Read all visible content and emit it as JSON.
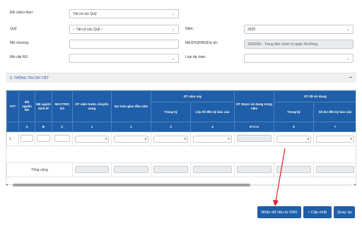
{
  "form": {
    "doi_chieu_label": "Đối chiếu theo:",
    "doi_chieu_value": "Tất cả các Quỹ",
    "quy_label": "Quỹ:",
    "quy_value": "-- Tất cả các Quỹ --",
    "nam_label": "Năm:",
    "nam_value": "2025",
    "ma_chuong_label": "Mã chương:",
    "ma_chuong_value": "",
    "ma_dvqhns_label": "Mã ĐVQHNS/Dự án:",
    "ma_dvqhns_value": "1025060 - Trung tâm chính trị quận Hà Đông",
    "ma_cap_ns_label": "Mã cấp NS:",
    "ma_cap_ns_value": "",
    "loai_du_toan_label": "Loại dự toán:",
    "loai_du_toan_value": ""
  },
  "section": {
    "title": "II. THÔNG TIN CHI TIẾT",
    "collapse_icon": "minus-icon"
  },
  "table": {
    "headers": {
      "stt": "STT",
      "ma_nguon": "Mã nguồn NS",
      "ma_nganh": "Mã ngành kinh tế",
      "ma_ctmt": "Mã CTMT, DA",
      "dt_nam_truoc": "DT năm trước chuyển sang",
      "du_toan_giao": "Dự toán giao đầu năm",
      "dt_nam_nay": "DT năm nay",
      "trong_ky": "Trong kỳ",
      "luy_ke": "Lũy kế đến kỳ báo cáo",
      "dt_duoc_su_dung": "DT được sử dụng trong năm",
      "dt_da_su_dung": "DT đã sử dụng",
      "trong_ky_2": "Trong kỳ",
      "so_du": "Số dư đến kỳ báo cáo"
    },
    "index_row": [
      "A",
      "B",
      "C",
      "1",
      "2",
      "3",
      "4",
      "5=1+4",
      "6",
      "7"
    ],
    "row": {
      "stt": "1",
      "values": [
        "0",
        "0",
        "0",
        "0",
        "",
        "0",
        "0"
      ]
    },
    "total_label": "Tổng cộng"
  },
  "buttons": {
    "import_label": "Nhận dữ liệu từ DAS",
    "update_label": "Cập nhật",
    "back_label": "Quay lại"
  }
}
